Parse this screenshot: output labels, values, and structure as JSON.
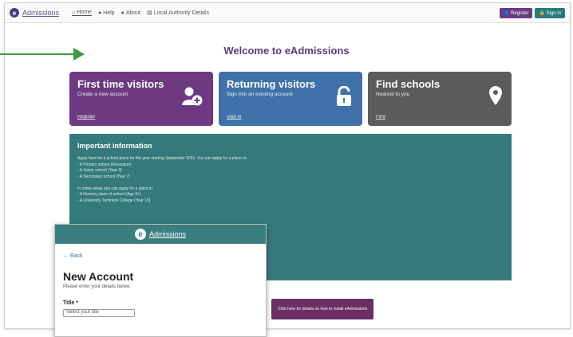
{
  "header": {
    "logo_letter": "e",
    "logo_text": "Admissions",
    "nav": [
      {
        "icon": "home-icon",
        "label": "Home"
      },
      {
        "icon": "help-icon",
        "label": "Help"
      },
      {
        "icon": "info-icon",
        "label": "About"
      },
      {
        "icon": "list-icon",
        "label": "Local Authority Details"
      }
    ],
    "register_label": "Register",
    "signin_label": "Sign in"
  },
  "main": {
    "title": "Welcome to eAdmissions",
    "cards": [
      {
        "title": "First time visitors",
        "subtitle": "Create a new account",
        "link": "Register",
        "icon": "add-user-icon",
        "color": "#6d3a82"
      },
      {
        "title": "Returning visitors",
        "subtitle": "Sign into an existing account",
        "link": "Sign in",
        "icon": "lock-icon",
        "color": "#3f72a8"
      },
      {
        "title": "Find schools",
        "subtitle": "Nearest to you",
        "link": "Find",
        "icon": "map-pin-icon",
        "color": "#5b5b5b"
      }
    ],
    "info": {
      "heading": "Important information",
      "body": "Apply here for a school place for the year starting September 2021. You can apply for a place in:\n- A Primary school (Reception)\n- A Junior school (Year 3)\n- A Secondary school (Year 7)\n\nIn some areas you can apply for a place in:\n- A Nursery class of school (Age 3+)\n- A University Technical College (Year 10)"
    },
    "banner": "Click here for details on how to install eAdmissions"
  },
  "overlay": {
    "logo_letter": "e",
    "logo_text": "Admissions",
    "back_label": "← Back",
    "form_title": "New Account",
    "form_subtitle": "Please enter your details below.",
    "field_label": "Title *",
    "select_value": "Select your title"
  },
  "colors": {
    "accent": "#6d3a82",
    "teal": "#347a7c",
    "arrow": "#3f9b3f"
  }
}
